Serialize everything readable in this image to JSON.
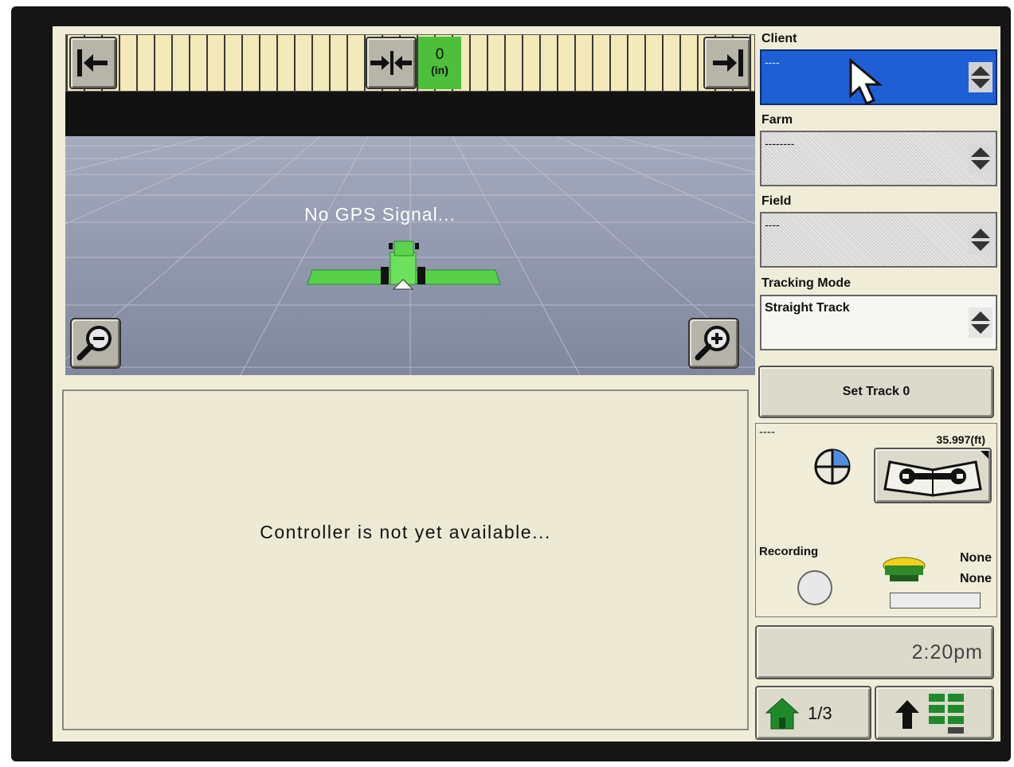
{
  "lightbar": {
    "offset_value": "0",
    "offset_unit": "(in)"
  },
  "map": {
    "status_message": "No GPS Signal..."
  },
  "controller": {
    "message": "Controller is not yet available..."
  },
  "panel": {
    "client": {
      "label": "Client",
      "value": "----"
    },
    "farm": {
      "label": "Farm",
      "value": "--------"
    },
    "field": {
      "label": "Field",
      "value": "----"
    },
    "tracking_mode": {
      "label": "Tracking Mode",
      "value": "Straight Track"
    },
    "set_track_label": "Set Track 0",
    "track_name": "----",
    "track_spacing": "35.997(ft)",
    "recording_label": "Recording",
    "receiver_status_1": "None",
    "receiver_status_2": "None",
    "clock": "2:20pm",
    "page_indicator": "1/3"
  },
  "colors": {
    "lightbar_on_target": "#4dbf3a",
    "selected_field": "#1e5fd6",
    "vehicle": "#57d14a"
  }
}
